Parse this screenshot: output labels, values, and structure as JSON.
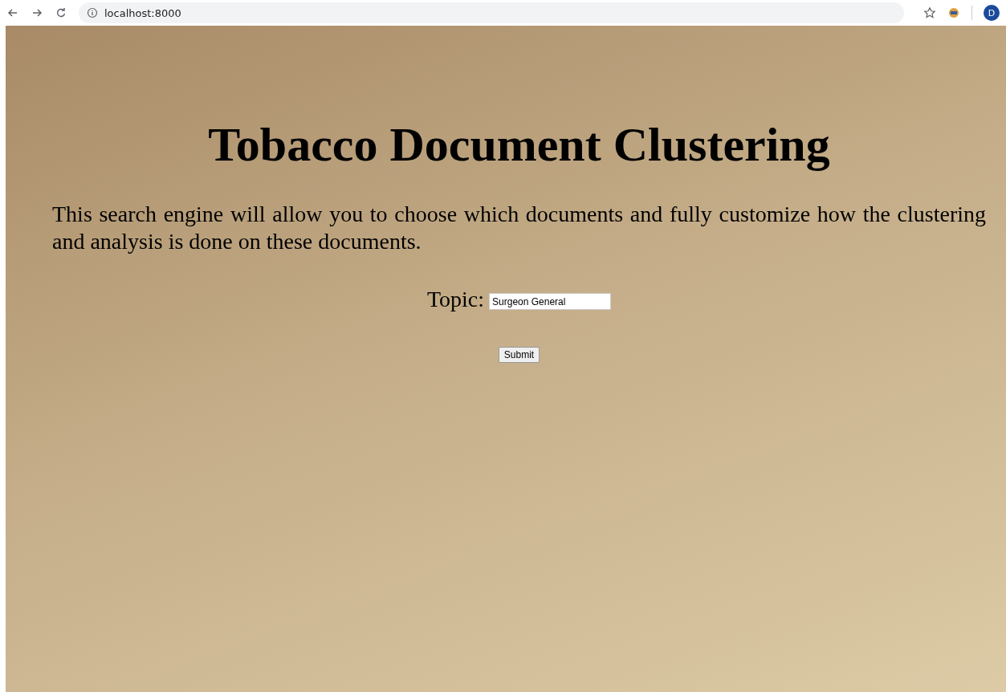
{
  "browser": {
    "url": "localhost:8000",
    "profile_initial": "D"
  },
  "page": {
    "title": "Tobacco Document Clustering",
    "description": "This search engine will allow you to choose which documents and fully customize how the clustering and analysis is done on these documents.",
    "topic": {
      "label": "Topic:",
      "value": "Surgeon General"
    },
    "submit": "Submit"
  }
}
